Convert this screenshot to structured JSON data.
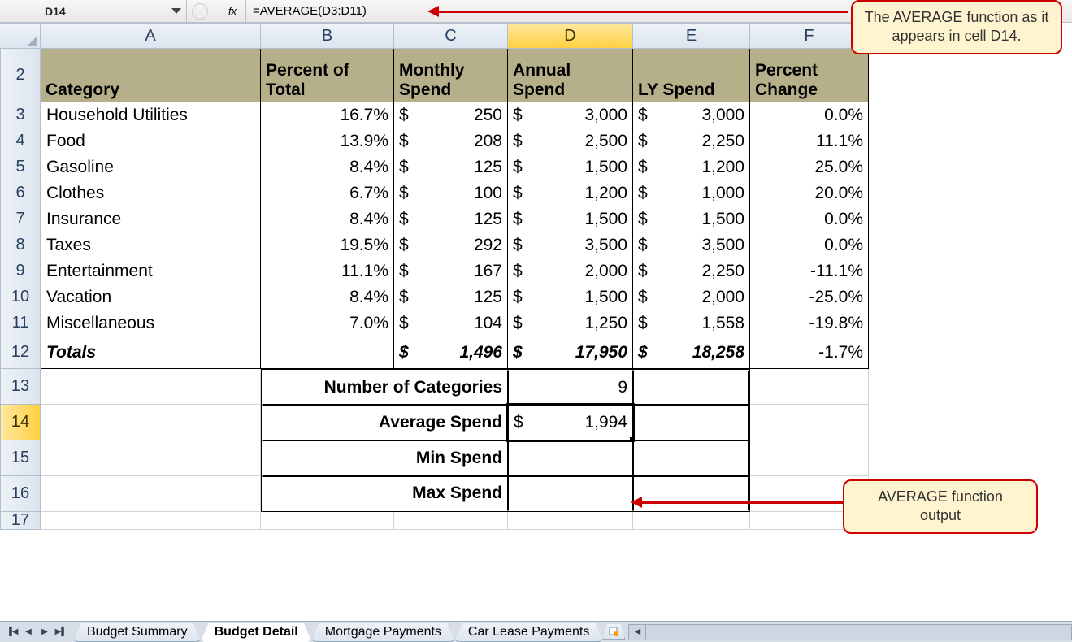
{
  "formula_bar": {
    "cell_ref": "D14",
    "formula": "=AVERAGE(D3:D11)",
    "fx_label": "fx"
  },
  "columns": [
    "A",
    "B",
    "C",
    "D",
    "E",
    "F"
  ],
  "selected_col": "D",
  "selected_row": "14",
  "header": {
    "A": "Category",
    "B": "Percent of Total",
    "C": "Monthly Spend",
    "D": "Annual Spend",
    "E": "LY Spend",
    "F": "Percent Change"
  },
  "rows": [
    {
      "r": "3",
      "cat": "Household Utilities",
      "pct": "16.7%",
      "mon": "250",
      "ann": "3,000",
      "ly": "3,000",
      "chg": "0.0%"
    },
    {
      "r": "4",
      "cat": "Food",
      "pct": "13.9%",
      "mon": "208",
      "ann": "2,500",
      "ly": "2,250",
      "chg": "11.1%"
    },
    {
      "r": "5",
      "cat": "Gasoline",
      "pct": "8.4%",
      "mon": "125",
      "ann": "1,500",
      "ly": "1,200",
      "chg": "25.0%"
    },
    {
      "r": "6",
      "cat": "Clothes",
      "pct": "6.7%",
      "mon": "100",
      "ann": "1,200",
      "ly": "1,000",
      "chg": "20.0%"
    },
    {
      "r": "7",
      "cat": "Insurance",
      "pct": "8.4%",
      "mon": "125",
      "ann": "1,500",
      "ly": "1,500",
      "chg": "0.0%"
    },
    {
      "r": "8",
      "cat": "Taxes",
      "pct": "19.5%",
      "mon": "292",
      "ann": "3,500",
      "ly": "3,500",
      "chg": "0.0%"
    },
    {
      "r": "9",
      "cat": "Entertainment",
      "pct": "11.1%",
      "mon": "167",
      "ann": "2,000",
      "ly": "2,250",
      "chg": "-11.1%"
    },
    {
      "r": "10",
      "cat": "Vacation",
      "pct": "8.4%",
      "mon": "125",
      "ann": "1,500",
      "ly": "2,000",
      "chg": "-25.0%"
    },
    {
      "r": "11",
      "cat": "Miscellaneous",
      "pct": "7.0%",
      "mon": "104",
      "ann": "1,250",
      "ly": "1,558",
      "chg": "-19.8%"
    }
  ],
  "totals": {
    "r": "12",
    "label": "Totals",
    "mon": "1,496",
    "ann": "17,950",
    "ly": "18,258",
    "chg": "-1.7%"
  },
  "summary": [
    {
      "r": "13",
      "label": "Number of Categories",
      "val": "9",
      "currency": false
    },
    {
      "r": "14",
      "label": "Average Spend",
      "val": "1,994",
      "currency": true,
      "selected": true
    },
    {
      "r": "15",
      "label": "Min Spend",
      "val": "",
      "currency": false
    },
    {
      "r": "16",
      "label": "Max Spend",
      "val": "",
      "currency": false
    }
  ],
  "row17": "17",
  "currency_symbol": "$",
  "sheet_tabs": [
    "Budget Summary",
    "Budget Detail",
    "Mortgage Payments",
    "Car Lease Payments"
  ],
  "active_tab_index": 1,
  "callouts": {
    "top": "The AVERAGE function as it appears in cell D14.",
    "bottom": "AVERAGE function output"
  }
}
